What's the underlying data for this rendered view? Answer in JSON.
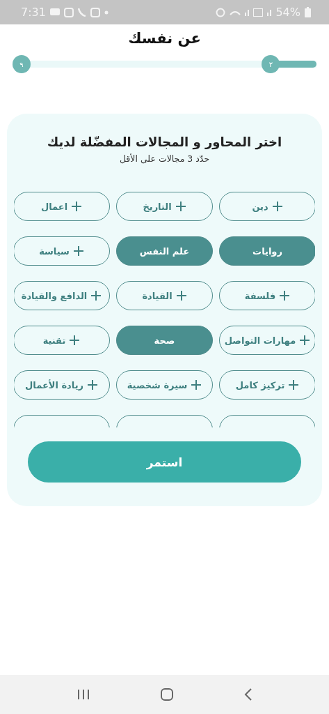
{
  "status_bar": {
    "time": "7:31",
    "battery": "54%"
  },
  "header": {
    "title": "عن نفسك"
  },
  "progress": {
    "current": "٢",
    "total": "٩",
    "level": 0.15
  },
  "card": {
    "title": "اختر المحاور و المجالات المفضّلة لديك",
    "subtitle": "حدّد 3 مجالات على الأقل",
    "chips": [
      {
        "label": "دين",
        "selected": false
      },
      {
        "label": "التاريخ",
        "selected": false
      },
      {
        "label": "اعمال",
        "selected": false
      },
      {
        "label": "روايات",
        "selected": true
      },
      {
        "label": "علم النفس",
        "selected": true
      },
      {
        "label": "سياسة",
        "selected": false
      },
      {
        "label": "فلسفة",
        "selected": false
      },
      {
        "label": "القيادة",
        "selected": false
      },
      {
        "label": "الدافع والقيادة",
        "selected": false
      },
      {
        "label": "مهارات التواصل",
        "selected": false
      },
      {
        "label": "صحة",
        "selected": true
      },
      {
        "label": "تقنية",
        "selected": false
      },
      {
        "label": "تركيز كامل",
        "selected": false
      },
      {
        "label": "سيرة شخصية",
        "selected": false
      },
      {
        "label": "ريادة الأعمال",
        "selected": false
      },
      {
        "kind": "clipped"
      },
      {
        "kind": "clipped"
      },
      {
        "kind": "clipped"
      }
    ],
    "button": "استمر"
  }
}
